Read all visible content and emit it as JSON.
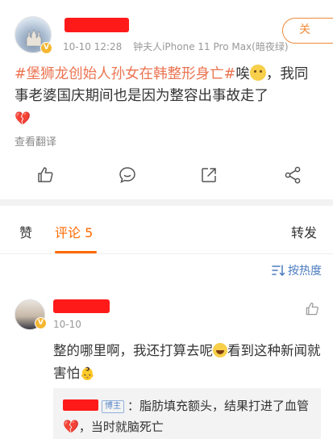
{
  "post": {
    "timestamp": "10-10 12:28",
    "device": "钟夫人iPhone 11 Pro Max(暗夜绿)",
    "follow_label": "关",
    "topic": "#堡狮龙创始人孙女在韩整形身亡#",
    "text_before_emoji": "唉",
    "text_after_emoji": "，我同事老婆国庆期间也是因为整容出事故走了",
    "translate_label": "查看翻译",
    "actions": [
      "like-icon",
      "comment-icon",
      "share-icon",
      "more-share-icon"
    ]
  },
  "tabs": {
    "likes": "赞",
    "comments": "评论 5",
    "reposts": "转发"
  },
  "sort": {
    "label": "按热度"
  },
  "comment": {
    "date": "10-10",
    "text_1": "整的哪里啊，我还打算去呢",
    "text_2": "看到这种新闻就害怕",
    "reply": {
      "owner_tag": "博主",
      "text_1": "：脂肪填充额头，结果打进了血管",
      "text_2": "，当时就脑死亡"
    }
  },
  "colors": {
    "accent": "#ff6a00",
    "topic": "#eb7350",
    "link": "#4a7bbf",
    "redaction": "#ff1a1a"
  }
}
